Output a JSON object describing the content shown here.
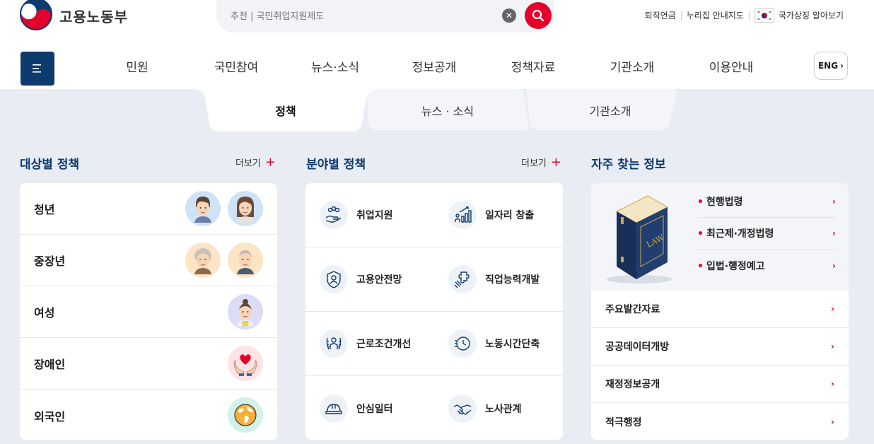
{
  "header": {
    "logo_text": "고용노동부",
    "search": {
      "placeholder": "추천 | 국민취업지원제도",
      "clear_icon": "close-icon",
      "search_icon": "search-icon"
    },
    "util_links": [
      "퇴직연금",
      "누리집 안내지도",
      "국가상징 알아보기"
    ]
  },
  "nav": {
    "items": [
      "민원",
      "국민참여",
      "뉴스·소식",
      "정보공개",
      "정책자료",
      "기관소개",
      "이용안내"
    ],
    "lang_label": "ENG"
  },
  "tabs": [
    "정책",
    "뉴스 · 소식",
    "기관소개"
  ],
  "target_policy": {
    "title": "대상별 정책",
    "more_label": "더보기",
    "rows": [
      {
        "label": "청년"
      },
      {
        "label": "중장년"
      },
      {
        "label": "여성"
      },
      {
        "label": "장애인"
      },
      {
        "label": "외국인"
      }
    ]
  },
  "field_policy": {
    "title": "분야별 정책",
    "more_label": "더보기",
    "items": [
      {
        "label": "취업지원",
        "icon": "handshake-hand-icon"
      },
      {
        "label": "일자리 창출",
        "icon": "growth-chart-icon"
      },
      {
        "label": "고용안전망",
        "icon": "shield-person-icon"
      },
      {
        "label": "직업능력개발",
        "icon": "puzzle-icon"
      },
      {
        "label": "근로조건개선",
        "icon": "laurel-person-icon"
      },
      {
        "label": "노동시간단축",
        "icon": "clock-icon"
      },
      {
        "label": "안심일터",
        "icon": "hardhat-icon"
      },
      {
        "label": "노사관계",
        "icon": "handshake-icon"
      }
    ]
  },
  "faq": {
    "title": "자주 찾는 정보",
    "book_label": "LAW",
    "law_links": [
      "현행법령",
      "최근제·개정법령",
      "입법·행정예고"
    ],
    "rows": [
      "주요발간자료",
      "공공데이터개방",
      "재정정보공개",
      "적극행정"
    ]
  },
  "colors": {
    "brand": "#0e3b6e",
    "accent": "#e4002b",
    "bg": "#e9edf3"
  }
}
